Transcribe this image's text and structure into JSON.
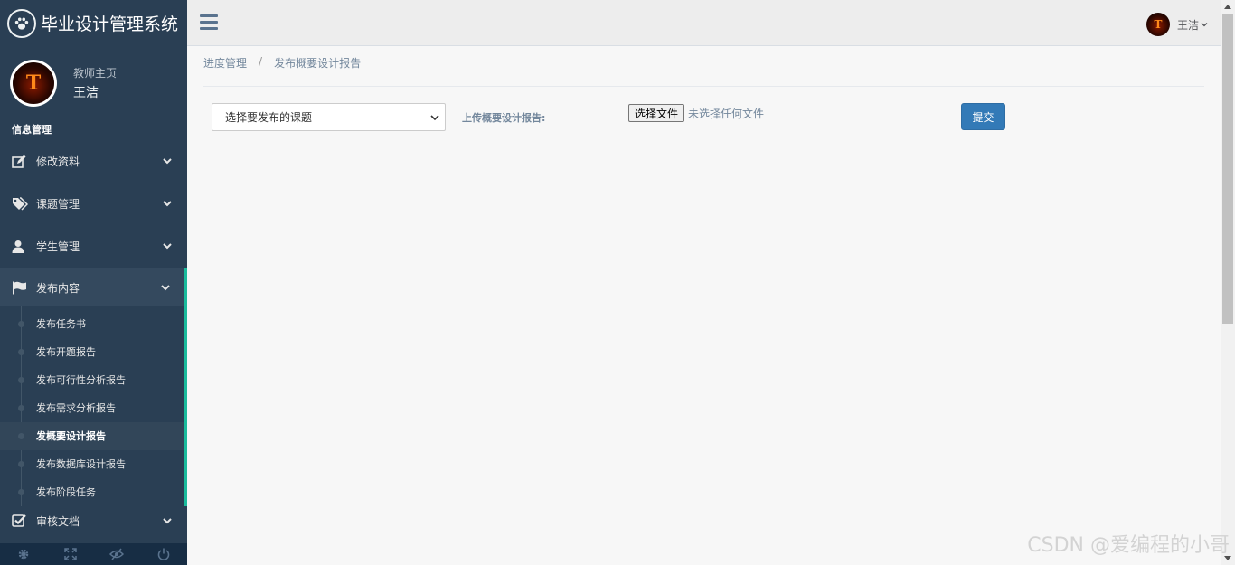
{
  "app": {
    "title": "毕业设计管理系统"
  },
  "profile": {
    "role": "教师主页",
    "name": "王洁",
    "avatar_letter": "T"
  },
  "sidebar": {
    "section_title": "信息管理",
    "items": [
      {
        "label": "修改资料",
        "icon": "edit-icon"
      },
      {
        "label": "课题管理",
        "icon": "tags-icon"
      },
      {
        "label": "学生管理",
        "icon": "user-icon"
      },
      {
        "label": "发布内容",
        "icon": "flag-icon"
      },
      {
        "label": "审核文档",
        "icon": "check-square-icon"
      }
    ],
    "submenu": [
      "发布任务书",
      "发布开题报告",
      "发布可行性分析报告",
      "发布需求分析报告",
      "发概要设计报告",
      "发布数据库设计报告",
      "发布阶段任务"
    ],
    "current_submenu_index": 4,
    "footer_icons": [
      "settings-icon",
      "fullscreen-icon",
      "hide-icon",
      "power-icon"
    ]
  },
  "topbar": {
    "user_name": "王洁"
  },
  "breadcrumb": {
    "parent": "进度管理",
    "separator": "/",
    "current": "发布概要设计报告"
  },
  "form": {
    "topic_select_value": "选择要发布的课题",
    "upload_label": "上传概要设计报告:",
    "file_button": "选择文件",
    "file_status": "未选择任何文件",
    "submit_label": "提交"
  },
  "watermark": "CSDN @爱编程的小哥",
  "colors": {
    "sidebar_bg": "#2a3f54",
    "accent": "#1abb9c",
    "primary": "#337ab7"
  }
}
